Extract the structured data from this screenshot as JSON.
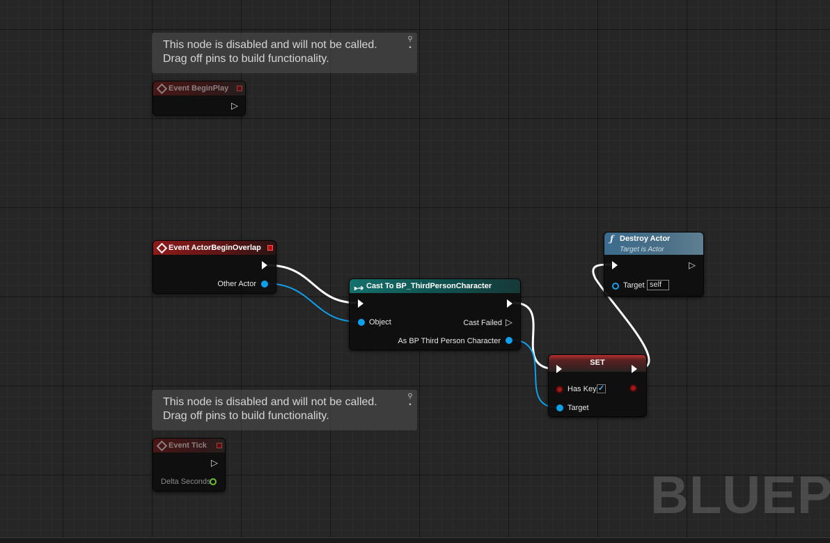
{
  "comments": [
    {
      "line1": "This node is disabled and will not be called.",
      "line2": "Drag off pins to build functionality."
    },
    {
      "line1": "This node is disabled and will not be called.",
      "line2": "Drag off pins to build functionality."
    }
  ],
  "nodes": {
    "begin_play": {
      "title": "Event BeginPlay"
    },
    "actor_begin_overlap": {
      "title": "Event ActorBeginOverlap",
      "pin_other_actor": "Other Actor"
    },
    "cast": {
      "title": "Cast To BP_ThirdPersonCharacter",
      "pin_object": "Object",
      "pin_cast_failed": "Cast Failed",
      "pin_as": "As BP Third Person Character"
    },
    "destroy_actor": {
      "title": "Destroy Actor",
      "subtitle": "Target is Actor",
      "pin_target": "Target",
      "target_default": "self"
    },
    "set": {
      "title": "SET",
      "pin_has_key": "Has Key",
      "has_key_value": "✓",
      "pin_target": "Target"
    },
    "tick": {
      "title": "Event Tick",
      "pin_delta": "Delta Seconds"
    }
  },
  "watermark": "BLUEPR",
  "colors": {
    "event_header": "#8e1a1a",
    "cast_header": "#15706c",
    "function_header": "#3c6c8e",
    "object_pin": "#0fa0ec",
    "bool_pin": "#a01818",
    "float_pin": "#6dbf3a",
    "exec_wire": "#ffffff"
  }
}
